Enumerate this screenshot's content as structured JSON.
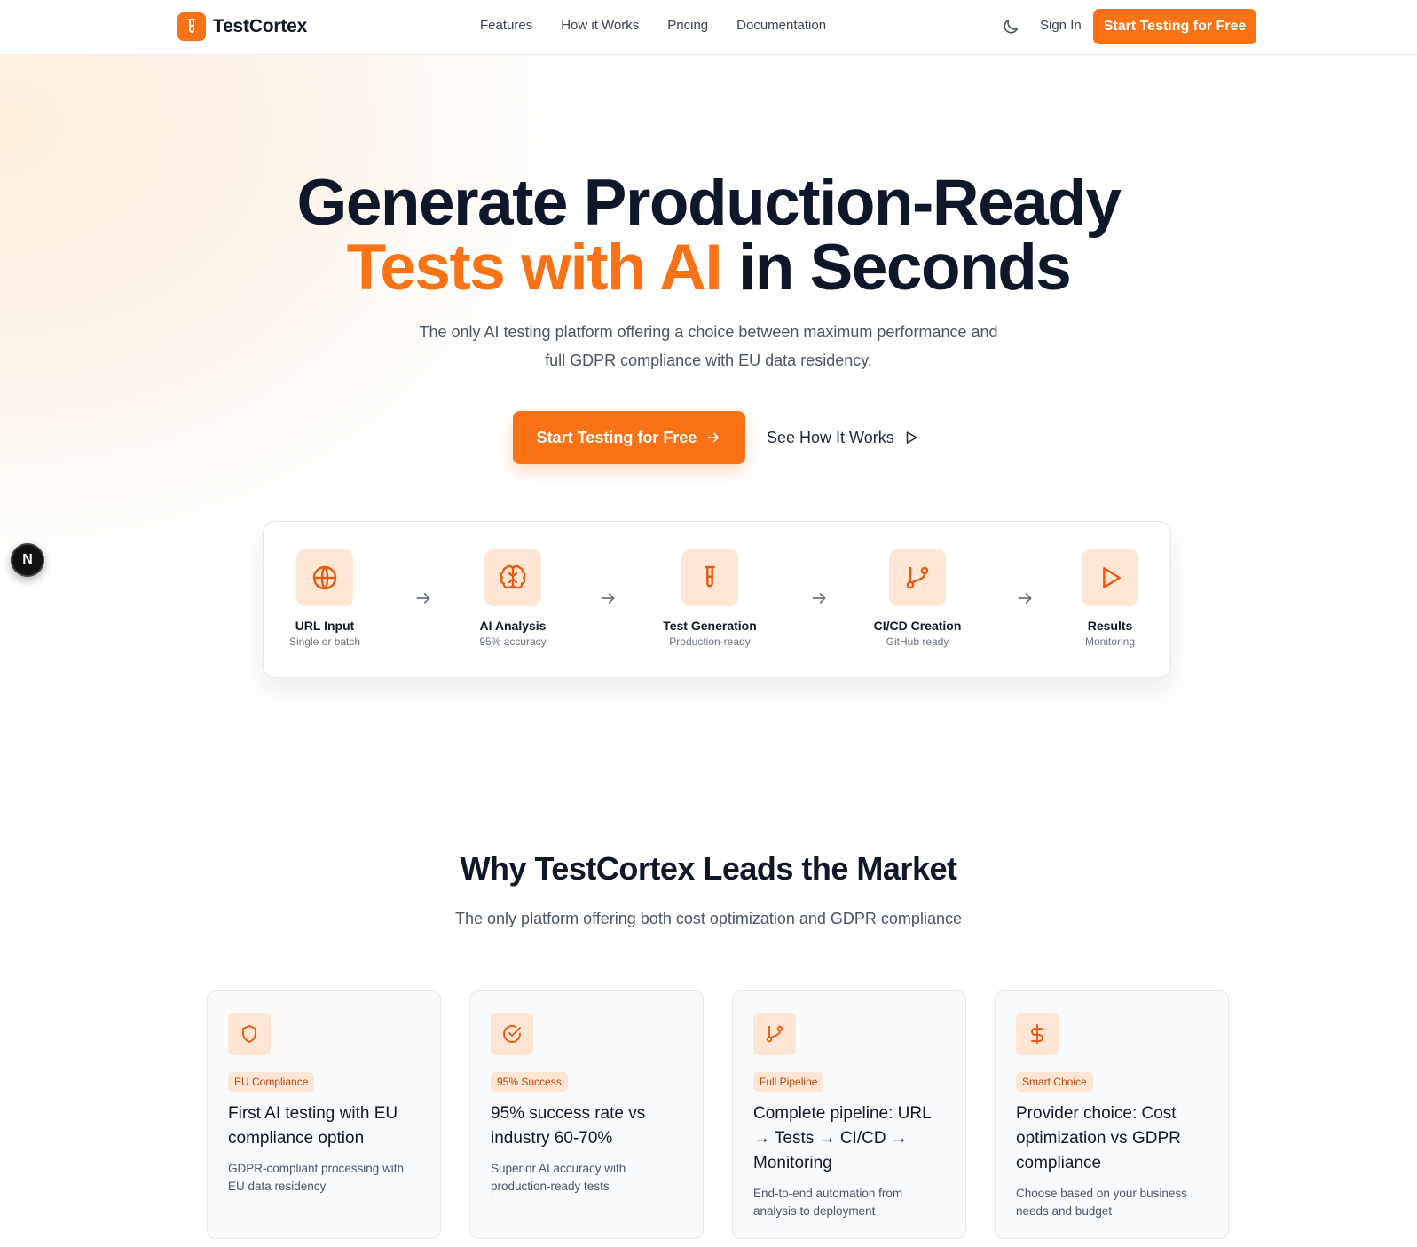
{
  "brand": {
    "name": "TestCortex",
    "accent": "#f97316"
  },
  "nav": {
    "links": [
      "Features",
      "How it Works",
      "Pricing",
      "Documentation"
    ],
    "theme_icon": "moon-icon",
    "sign_in": "Sign In",
    "cta": "Start Testing for Free"
  },
  "hero": {
    "title_line1": "Generate Production-Ready",
    "title_accent": "Tests with AI",
    "title_rest": " in Seconds",
    "subtitle": "The only AI testing platform offering a choice between maximum performance and full GDPR compliance with EU data residency.",
    "cta_primary": "Start Testing for Free",
    "cta_secondary": "See How It Works"
  },
  "pipeline": {
    "steps": [
      {
        "title": "URL Input",
        "desc": "Single or batch",
        "icon": "globe-icon"
      },
      {
        "title": "AI Analysis",
        "desc": "95% accuracy",
        "icon": "brain-icon"
      },
      {
        "title": "Test Generation",
        "desc": "Production-ready",
        "icon": "test-tube-icon"
      },
      {
        "title": "CI/CD Creation",
        "desc": "GitHub ready",
        "icon": "git-branch-icon"
      },
      {
        "title": "Results",
        "desc": "Monitoring",
        "icon": "play-icon"
      }
    ]
  },
  "side_badge": "N",
  "why": {
    "title": "Why TestCortex Leads the Market",
    "subtitle": "The only platform offering both cost optimization and GDPR compliance",
    "cards": [
      {
        "badge": "EU Compliance",
        "title": "First AI testing with EU compliance option",
        "desc": "GDPR-compliant processing with EU data residency",
        "icon": "shield-icon"
      },
      {
        "badge": "95% Success",
        "title": "95% success rate vs industry 60-70%",
        "desc": "Superior AI accuracy with production-ready tests",
        "icon": "check-circle-icon"
      },
      {
        "badge": "Full Pipeline",
        "title": "Complete pipeline: URL → Tests → CI/CD → Monitoring",
        "desc": "End-to-end automation from analysis to deployment",
        "icon": "git-branch-icon"
      },
      {
        "badge": "Smart Choice",
        "title": "Provider choice: Cost optimization vs GDPR compliance",
        "desc": "Choose based on your business needs and budget",
        "icon": "dollar-icon"
      }
    ]
  }
}
